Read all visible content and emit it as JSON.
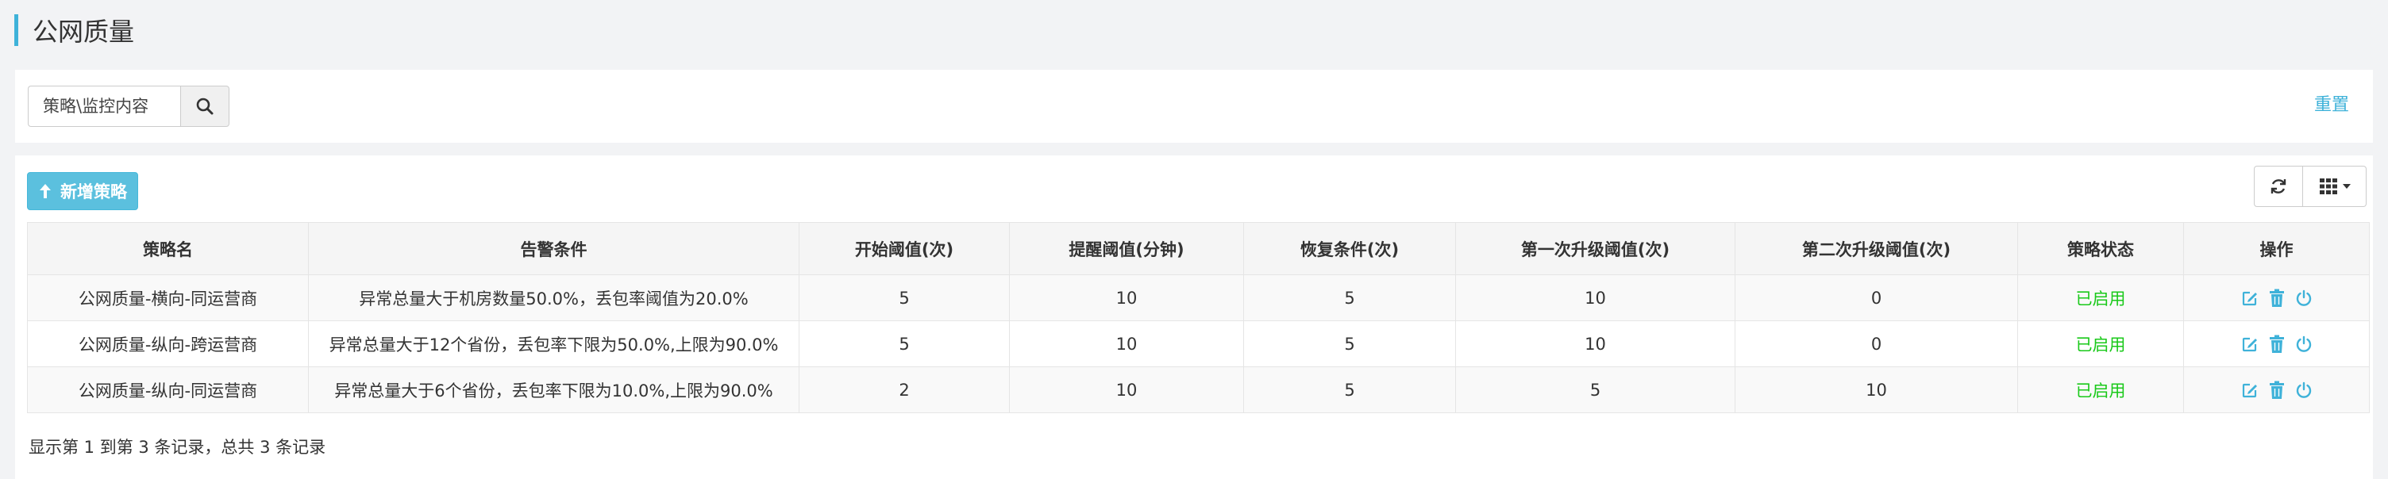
{
  "header": {
    "title": "公网质量"
  },
  "search": {
    "placeholder": "策略\\监控内容",
    "value": "",
    "reset_label": "重置"
  },
  "toolbar": {
    "add_label": "新增策略"
  },
  "table": {
    "columns": [
      "策略名",
      "告警条件",
      "开始阈值(次)",
      "提醒阈值(分钟)",
      "恢复条件(次)",
      "第一次升级阈值(次)",
      "第二次升级阈值(次)",
      "策略状态",
      "操作"
    ],
    "rows": [
      {
        "name": "公网质量-横向-同运营商",
        "condition": "异常总量大于机房数量50.0%，丢包率阈值为20.0%",
        "start": "5",
        "remind": "10",
        "recover": "5",
        "up1": "10",
        "up2": "0",
        "status": "已启用"
      },
      {
        "name": "公网质量-纵向-跨运营商",
        "condition": "异常总量大于12个省份，丢包率下限为50.0%,上限为90.0%",
        "start": "5",
        "remind": "10",
        "recover": "5",
        "up1": "10",
        "up2": "0",
        "status": "已启用"
      },
      {
        "name": "公网质量-纵向-同运营商",
        "condition": "异常总量大于6个省份，丢包率下限为10.0%,上限为90.0%",
        "start": "2",
        "remind": "10",
        "recover": "5",
        "up1": "5",
        "up2": "10",
        "status": "已启用"
      }
    ]
  },
  "footer": {
    "info": "显示第 1 到第 3 条记录，总共 3 条记录"
  },
  "colors": {
    "accent": "#3fb2d9",
    "button": "#5bc0de",
    "status_ok": "#19c919"
  },
  "icons": {
    "search": "search-icon",
    "add": "arrow-up-icon",
    "refresh": "refresh-icon",
    "columns": "grid-icon",
    "edit": "edit-icon",
    "delete": "trash-icon",
    "power": "power-icon"
  }
}
